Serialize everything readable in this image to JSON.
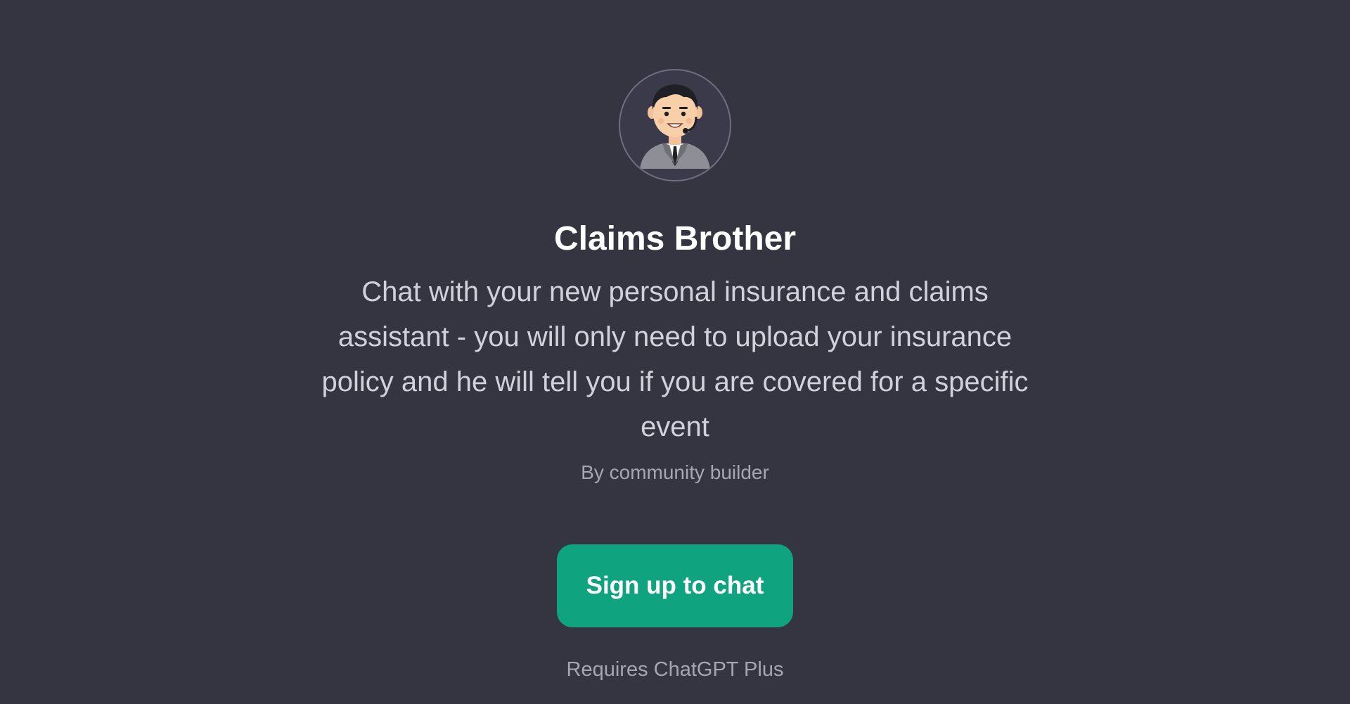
{
  "gpt": {
    "avatar_icon": "support-agent-with-headset-icon",
    "name": "Claims Brother",
    "description": "Chat with your new personal insurance and claims assistant - you will only need to upload your insurance policy and he will tell you if you are covered for a specific event",
    "author": "By community builder"
  },
  "cta": {
    "label": "Sign up to chat",
    "color": "#10a37f"
  },
  "footer": {
    "requirement": "Requires ChatGPT Plus"
  },
  "theme": {
    "background": "#343541"
  }
}
